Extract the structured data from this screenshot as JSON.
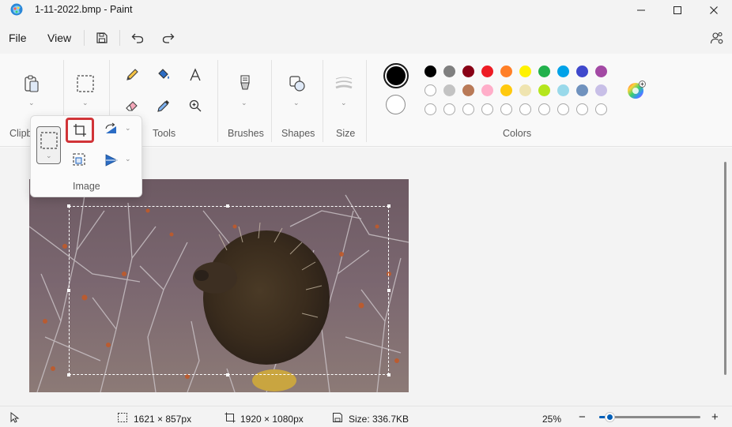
{
  "window": {
    "title": "1-11-2022.bmp - Paint",
    "minimize_icon": "minimize-icon",
    "maximize_icon": "maximize-icon",
    "close_icon": "close-icon"
  },
  "menu": {
    "file": "File",
    "view": "View",
    "quick_access": [
      "save-icon",
      "undo-icon",
      "redo-icon"
    ],
    "account_icon": "people-settings-icon"
  },
  "ribbon": {
    "groups": {
      "clipboard": "Clipb",
      "tools": "Tools",
      "brushes": "Brushes",
      "shapes": "Shapes",
      "size": "Size",
      "colors": "Colors"
    },
    "tools": [
      "pencil-icon",
      "fill-icon",
      "text-icon",
      "eraser-icon",
      "color-picker-icon",
      "magnifier-icon"
    ]
  },
  "image_popup": {
    "label": "Image",
    "items": [
      "select-icon",
      "crop-icon",
      "rotate-icon",
      "resize-icon",
      "flip-icon"
    ],
    "highlighted": "crop-icon"
  },
  "colors": {
    "color1": "#000000",
    "color2": "#ffffff",
    "row1": [
      "#000000",
      "#7f7f7f",
      "#880015",
      "#ed1c24",
      "#ff7f27",
      "#fff200",
      "#22b14c",
      "#00a2e8",
      "#3f48cc",
      "#a349a4"
    ],
    "row2": [
      "#ffffff",
      "#c3c3c3",
      "#b97a57",
      "#ffaec9",
      "#ffc90e",
      "#efe4b0",
      "#b5e61d",
      "#99d9ea",
      "#7092be",
      "#c8bfe7"
    ],
    "row3_empty": 10,
    "edit_colors_icon": "color-wheel-icon",
    "highlight": "#d13438",
    "accent": "#005fb8"
  },
  "status": {
    "selection_size": "1621 × 857px",
    "canvas_size": "1920 × 1080px",
    "file_size": "Size: 336.7KB",
    "zoom": "25%",
    "zoom_out": "−",
    "zoom_in": "+",
    "zoom_level": 0.1
  }
}
